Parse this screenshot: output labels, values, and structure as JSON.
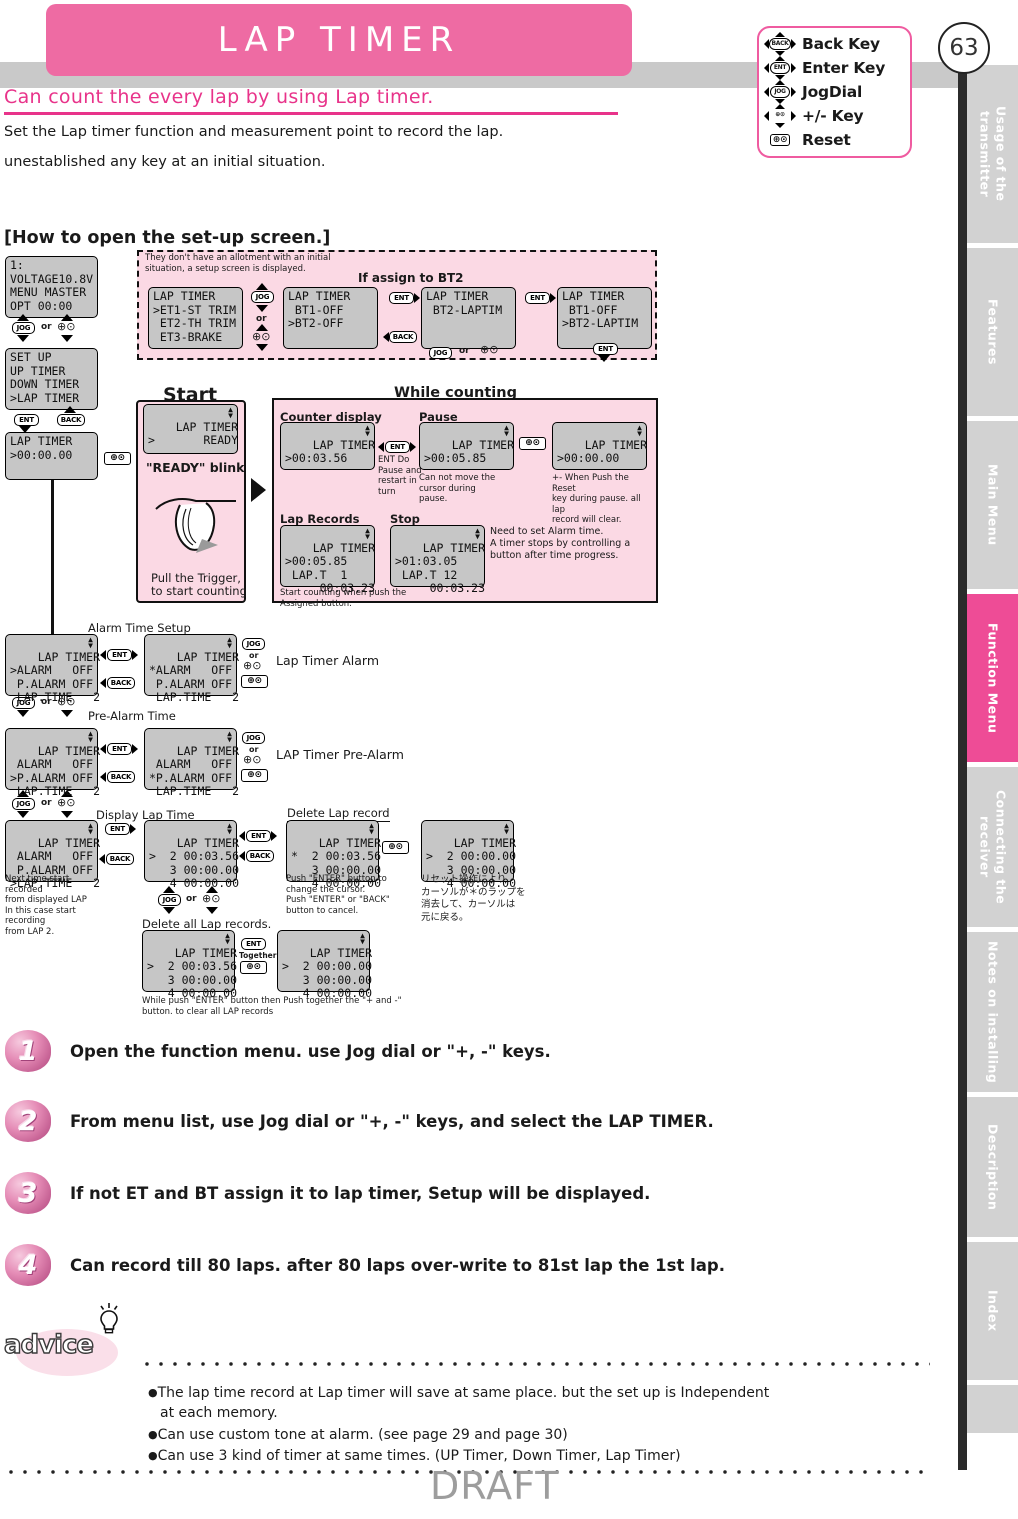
{
  "header": {
    "title": "LAP TIMER",
    "page_number": "63"
  },
  "key_legend": [
    {
      "icon": "back-key-icon",
      "glyph": "BACK",
      "label": "Back Key"
    },
    {
      "icon": "enter-key-icon",
      "glyph": "ENT",
      "label": "Enter Key"
    },
    {
      "icon": "jogdial-icon",
      "glyph": "JOG",
      "label": "JogDial"
    },
    {
      "icon": "plus-minus-key-icon",
      "glyph": "⊕⊙",
      "label": "+/- Key"
    },
    {
      "icon": "reset-key-icon",
      "glyph": "⊕⊙",
      "label": "Reset"
    }
  ],
  "sidebar": {
    "tabs": [
      {
        "label": "Usage of the transmitter",
        "active": false
      },
      {
        "label": "Features",
        "active": false
      },
      {
        "label": "Main Menu",
        "active": false
      },
      {
        "label": "Function Menu",
        "active": true
      },
      {
        "label": "Connecting the receiver",
        "active": false
      },
      {
        "label": "Notes on installing",
        "active": false
      },
      {
        "label": "Description",
        "active": false
      },
      {
        "label": "Index",
        "active": false
      }
    ],
    "active_color": "#ee4c96",
    "inactive_color": "#d2d2d2"
  },
  "intro": {
    "headline": "Can count the every lap by using Lap timer.",
    "line1": "Set the Lap timer function and measurement point to record the lap.",
    "line2": "unestablished any key at an initial situation."
  },
  "section": {
    "howto_title": "[How to open the set-up screen.]"
  },
  "setup_block": {
    "note": "They don't have an allotment with an initial\nsituation, a setup screen is displayed.",
    "assign_title": "If assign to BT2",
    "screen1": "LAP TIMER\n>ET1-ST TRIM\n ET2-TH TRIM\n ET3-BRAKE",
    "screen2": "LAP TIMER\n BT1-OFF\n>BT2-OFF",
    "screen3": "LAP TIMER\n BT2-LAPTIM",
    "screen4": "LAP TIMER\n BT1-OFF\n>BT2-LAPTIM",
    "jog_label": "JOG",
    "or_label": "or",
    "ent_label": "ENT",
    "back_label": "BACK"
  },
  "left_flow": {
    "screen_status": "1:\nVOLTAGE10.8V\nMENU MASTER\nOPT 00:00",
    "screen_menu": "SET UP\nUP TIMER\nDOWN TIMER\n>LAP TIMER",
    "screen_laptimer": "LAP TIMER\n>00:00.00",
    "jog_label": "JOG",
    "or_label": "or",
    "ent_label": "ENT",
    "back_label": "BACK"
  },
  "start_block": {
    "title": "Start",
    "screen": "LAP TIMER\n>       READY",
    "blink_caption": "\"READY\" blink",
    "trigger_caption": "Pull the Trigger,\nto start counting"
  },
  "counting_block": {
    "title": "While counting",
    "counter_label": "Counter display",
    "counter_screen": "LAP TIMER\n>00:03.56",
    "ent_note": "ENT Do\nPause and\nrestart in turn",
    "pause_label": "Pause",
    "pause_screen": "LAP TIMER\n>00:05.85",
    "pause_note": "Can not move the\ncursor during\npause.",
    "reset_screen": "LAP TIMER\n>00:00.00",
    "reset_note": "+- When Push the Reset\nkey during pause. all lap\nrecord will clear.",
    "lap_label": "Lap Records",
    "lap_screen": "LAP TIMER\n>00:05.85\n LAP.T  1\n     00:03.23",
    "lap_note": "Start counting when push the\nAssigned button.",
    "stop_label": "Stop",
    "stop_screen": "LAP TIMER\n>01:03.05\n LAP.T 12\n     00:03.23",
    "stop_note": "Need to set Alarm time.\nA timer stops by controlling a\nbutton after time progress."
  },
  "alarm_block": {
    "title": "Alarm Time Setup",
    "screen_a": "LAP TIMER\n>ALARM   OFF\n P.ALARM OFF\n LAP.TIME   2",
    "screen_b": "LAP TIMER\n*ALARM   OFF\n P.ALARM OFF\n LAP.TIME   2",
    "right_label": "Lap Timer Alarm"
  },
  "prealarm_block": {
    "title": "Pre-Alarm Time",
    "screen_a": "LAP TIMER\n ALARM   OFF\n>P.ALARM OFF\n LAP.TIME   2",
    "screen_b": "LAP TIMER\n ALARM   OFF\n*P.ALARM OFF\n LAP.TIME   2",
    "right_label": "LAP Timer Pre-Alarm"
  },
  "laptime_block": {
    "title": "Display Lap Time",
    "screen_a": "LAP TIMER\n ALARM   OFF\n P.ALARM OFF\n>LAP.TIME   2",
    "note_a": "Next time start recorded\nfrom displayed LAP\nIn this case start recording\nfrom LAP 2.",
    "screen_b": "LAP TIMER\n>  2 00:03.56\n   3 00:00.00\n   4 00:00.00",
    "delete_title": "Delete Lap record",
    "screen_c": "LAP TIMER\n*  2 00:03.56\n   3 00:00.00\n   4 00:00.00",
    "note_c": "Push \"ENTER\" button to\nchange the cursor.\nPush \"ENTER\" or \"BACK\"\nbutton to cancel.",
    "screen_d": "LAP TIMER\n>  2 00:00.00\n   3 00:00.00\n   4 00:00.00",
    "note_d": "リセット操作により\nカーソルが＊のラップを\n消去して、カーソルは\n元に戻る。"
  },
  "deleteall_block": {
    "title": "Delete all Lap records.",
    "screen_a": "LAP TIMER\n>  2 00:03.56\n   3 00:00.00\n   4 00:00.00",
    "screen_b": "LAP TIMER\n>  2 00:00.00\n   3 00:00.00\n   4 00:00.00",
    "together_label": "Together",
    "ent_label": "ENT",
    "note": "While push \"ENTER\" button then Push together the \"+ and -\"\nbutton. to clear all LAP records"
  },
  "steps": [
    {
      "num": "1",
      "text": "Open the function menu. use Jog dial or \"+, -\" keys."
    },
    {
      "num": "2",
      "text": "From menu list, use Jog dial or \"+, -\" keys, and select the LAP TIMER."
    },
    {
      "num": "3",
      "text": "If not ET and BT assign it to lap timer, Setup will be displayed."
    },
    {
      "num": "4",
      "text": "Can record till 80 laps. after 80 laps over-write to 81st lap the 1st lap."
    }
  ],
  "advice": {
    "word": "advice",
    "items": [
      "The lap time record at Lap timer will save at same place. but the set up is Independent",
      "at each memory.",
      "Can use custom tone at alarm. (see page 29 and page 30)",
      "Can use 3 kind of timer at same times. (UP Timer, Down Timer, Lap Timer)"
    ]
  },
  "watermark": "DRAFT",
  "colors": {
    "brand_pink": "#ee6ba3",
    "accent_pink": "#e8338a",
    "tab_active": "#ee4c96",
    "lcd_bg": "#c6c6c6",
    "panel_pink": "#fbd9e4"
  }
}
